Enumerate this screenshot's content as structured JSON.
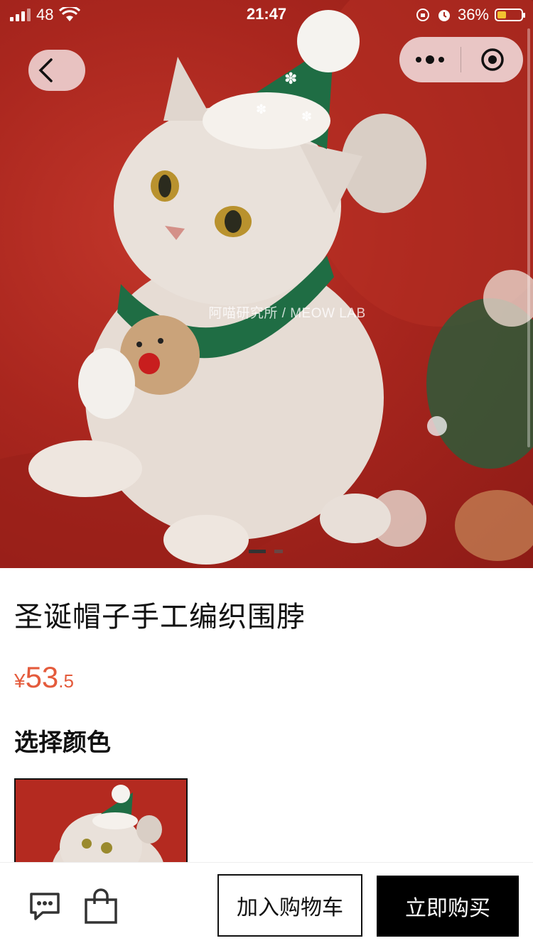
{
  "status_bar": {
    "signal": "48",
    "time": "21:47",
    "battery": "36%",
    "battery_level": 0.36
  },
  "nav": {
    "back_icon": "chevron-left-icon",
    "more_icon": "more-dots-icon",
    "close_icon": "target-circle-icon"
  },
  "hero": {
    "watermark": "阿喵研究所 / MEOW LAB",
    "carousel_pages": 2,
    "carousel_active": 0
  },
  "product": {
    "title": "圣诞帽子手工编织围脖",
    "price_currency": "¥",
    "price_integer": "53",
    "price_decimal": ".5",
    "price_color": "#e45b3c"
  },
  "options": {
    "section_title": "选择颜色"
  },
  "bottom_bar": {
    "chat_icon": "chat-bubble-icon",
    "bag_icon": "shopping-bag-icon",
    "add_to_cart": "加入购物车",
    "buy_now": "立即购买"
  }
}
